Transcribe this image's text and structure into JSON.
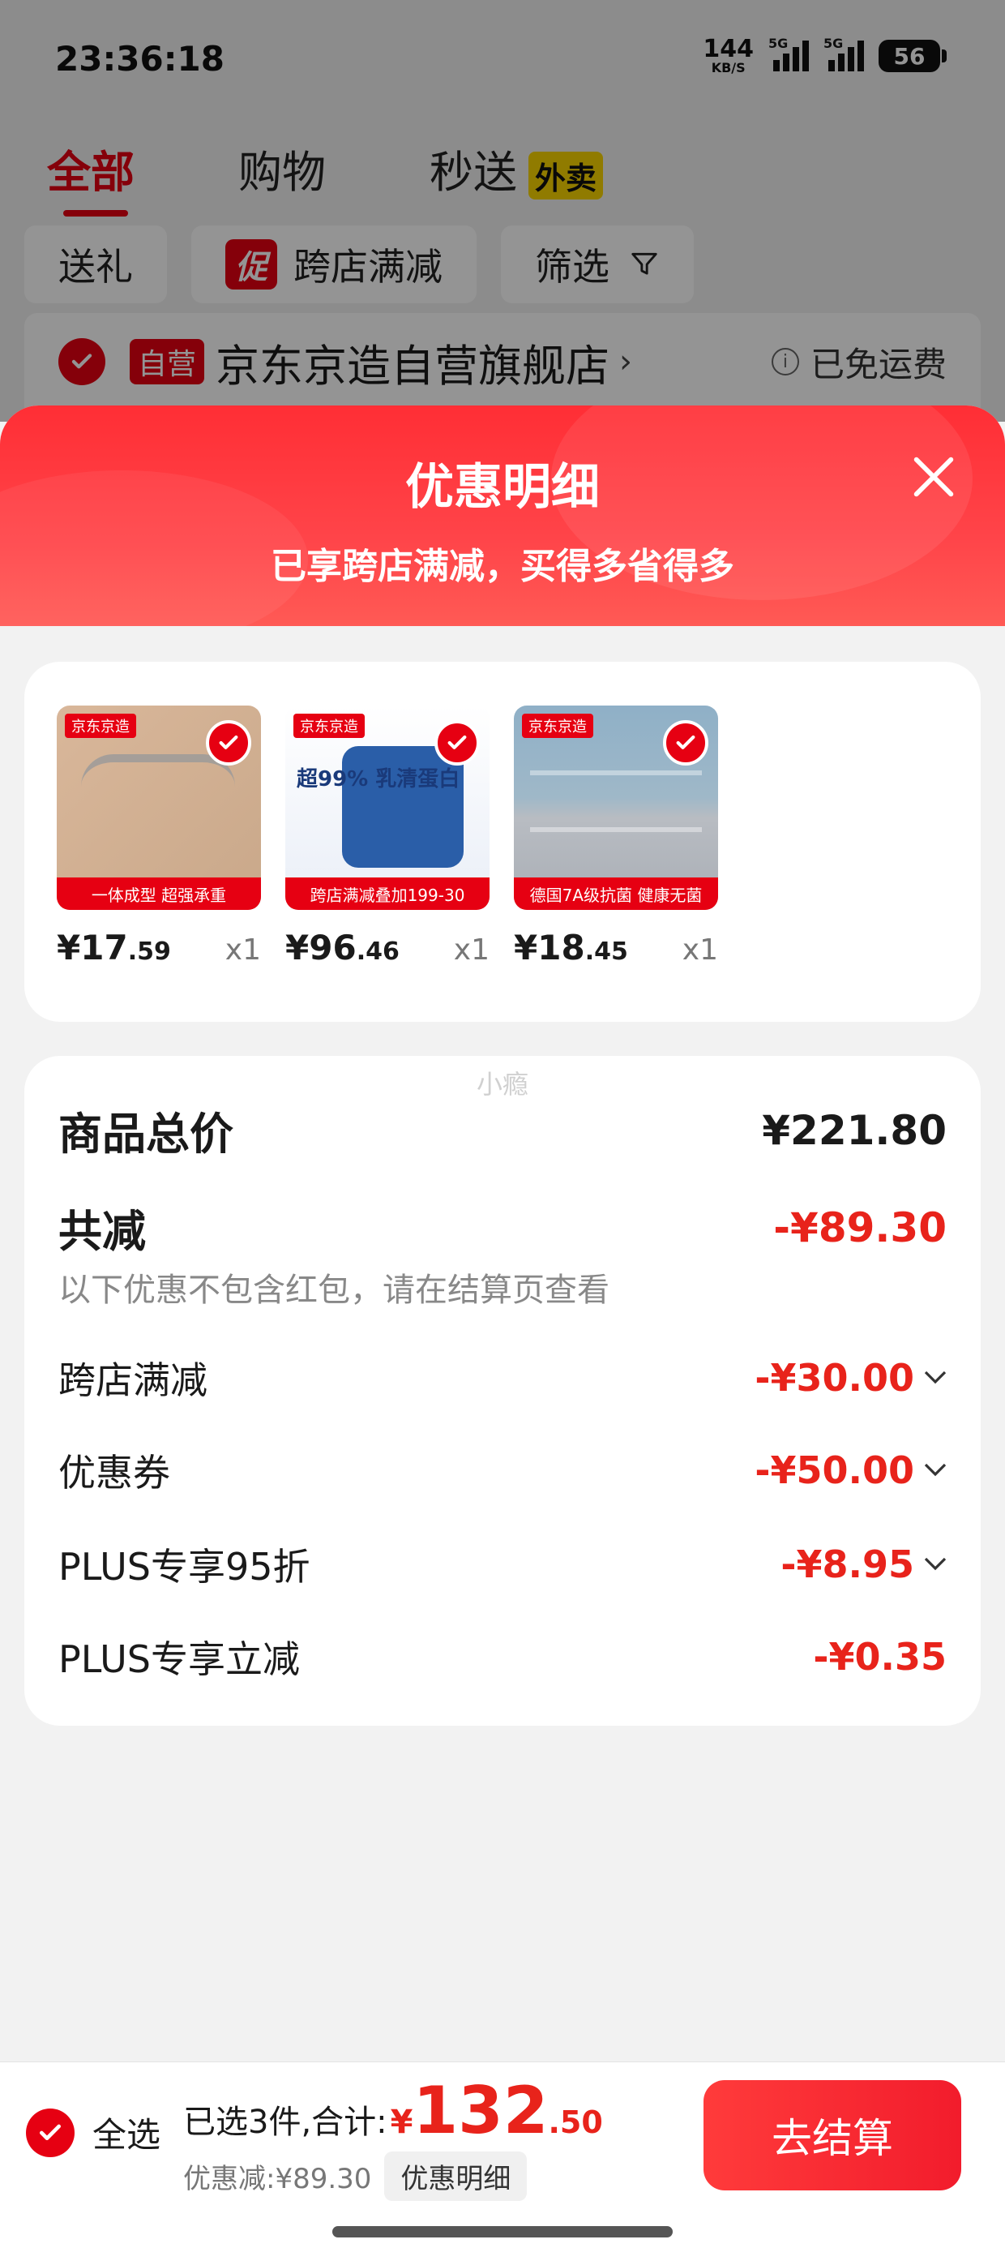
{
  "status_bar": {
    "time": "23:36:18",
    "net_speed_value": "144",
    "net_speed_unit": "KB/S",
    "signal_1": "5G",
    "signal_2": "5G",
    "battery": "56"
  },
  "top_tabs": [
    {
      "label": "全部",
      "active": true
    },
    {
      "label": "购物",
      "active": false
    },
    {
      "label": "秒送",
      "active": false,
      "badge": "外卖"
    }
  ],
  "filters": {
    "gift": "送礼",
    "promo_badge": "促",
    "promo": "跨店满减",
    "filter": "筛选"
  },
  "store": {
    "badge": "自营",
    "name": "京东京造自营旗舰店",
    "chevron": "›",
    "shipping": "已免运费"
  },
  "sheet": {
    "title": "优惠明细",
    "subtitle": "已享跨店满减，买得多省得多"
  },
  "products": [
    {
      "currency": "¥",
      "price_int": "17",
      "price_dec": ".59",
      "qty": "x1",
      "brand": "京东京造",
      "tagline": "一体成型 超强承重"
    },
    {
      "currency": "¥",
      "price_int": "96",
      "price_dec": ".46",
      "qty": "x1",
      "brand": "京东京造",
      "tagline": "跨店满减叠加199-30",
      "label": "超99% 乳清蛋白"
    },
    {
      "currency": "¥",
      "price_int": "18",
      "price_dec": ".45",
      "qty": "x1",
      "brand": "京东京造",
      "tagline": "德国7A级抗菌 健康无菌"
    }
  ],
  "summary": {
    "watermark": "小瘾",
    "total_label": "商品总价",
    "total_value": "¥221.80",
    "reduce_label": "共减",
    "reduce_value": "-¥89.30",
    "note": "以下优惠不包含红包，请在结算页查看",
    "discounts": [
      {
        "label": "跨店满减",
        "value": "-¥30.00",
        "expandable": true
      },
      {
        "label": "优惠券",
        "value": "-¥50.00",
        "expandable": true
      },
      {
        "label": "PLUS专享95折",
        "value": "-¥8.95",
        "expandable": true
      },
      {
        "label": "PLUS专享立减",
        "value": "-¥0.35",
        "expandable": false
      }
    ]
  },
  "bottom_bar": {
    "select_all": "全选",
    "selected_text": "已选3件,合计:",
    "currency": "¥",
    "total_int": "132",
    "total_dec": ".50",
    "saved_text": "优惠减:¥89.30",
    "detail_button": "优惠明细",
    "checkout_button": "去结算"
  },
  "colors": {
    "brand_red": "#e60012",
    "discount_red": "#e8231b",
    "header_gradient_start": "#ff2e35",
    "header_gradient_end": "#ff5a55",
    "takeout_yellow": "#f9d500"
  }
}
